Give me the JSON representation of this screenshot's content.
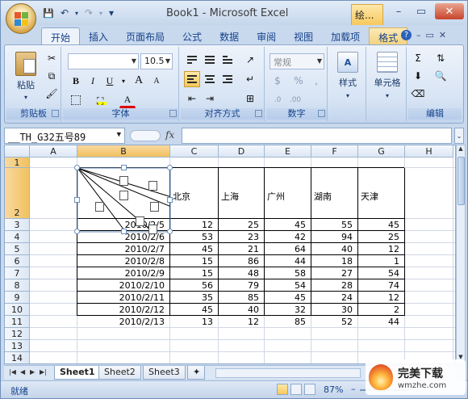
{
  "window": {
    "title": "Book1 - Microsoft Excel",
    "context_tab": "绘...",
    "minimize": "–",
    "restore": "▭",
    "close": "✕"
  },
  "qat": {
    "save": "💾",
    "undo": "↶",
    "redo": "↷",
    "more": "▾"
  },
  "ribbon_tabs": [
    "开始",
    "插入",
    "页面布局",
    "公式",
    "数据",
    "审阅",
    "视图",
    "加载项",
    "格式"
  ],
  "ribbon_right": {
    "help": "?",
    "min": "–",
    "restore": "▭",
    "close": "✕"
  },
  "groups": {
    "clipboard": {
      "label": "剪贴板",
      "paste": "粘贴"
    },
    "font": {
      "label": "字体",
      "size": "10.5",
      "bold": "B",
      "italic": "I",
      "underline": "U",
      "grow": "A",
      "shrink": "A",
      "font_color": "A"
    },
    "alignment": {
      "label": "对齐方式"
    },
    "number": {
      "label": "数字",
      "format": "常规",
      "percent": "%",
      "comma": ","
    },
    "style": {
      "label": "样式"
    },
    "cells": {
      "label": "单元格"
    },
    "editing": {
      "label": "编辑"
    }
  },
  "formula_bar": {
    "name_box": "__TH_G32五号89",
    "fx": "fx",
    "value": ""
  },
  "columns": [
    "A",
    "B",
    "C",
    "D",
    "E",
    "F",
    "G",
    "H"
  ],
  "rows": [
    "1",
    "2",
    "3",
    "4",
    "5",
    "6",
    "7",
    "8",
    "9",
    "10",
    "11",
    "12",
    "13",
    "14"
  ],
  "table": {
    "headers": [
      "北京",
      "上海",
      "广州",
      "湖南",
      "天津"
    ],
    "rows": [
      [
        "2010/2/5",
        "12",
        "25",
        "45",
        "55",
        "45"
      ],
      [
        "2010/2/6",
        "53",
        "23",
        "42",
        "94",
        "25"
      ],
      [
        "2010/2/7",
        "45",
        "21",
        "64",
        "40",
        "12"
      ],
      [
        "2010/2/8",
        "15",
        "86",
        "44",
        "18",
        "1"
      ],
      [
        "2010/2/9",
        "15",
        "48",
        "58",
        "27",
        "54"
      ],
      [
        "2010/2/10",
        "56",
        "79",
        "54",
        "28",
        "74"
      ],
      [
        "2010/2/11",
        "35",
        "85",
        "45",
        "24",
        "12"
      ],
      [
        "2010/2/12",
        "45",
        "40",
        "32",
        "30",
        "2"
      ],
      [
        "2010/2/13",
        "13",
        "12",
        "85",
        "52",
        "44"
      ]
    ]
  },
  "sheet_tabs": [
    "Sheet1",
    "Sheet2",
    "Sheet3"
  ],
  "status": {
    "ready": "就绪",
    "zoom": "87%",
    "zoom_minus": "–",
    "zoom_plus": "+"
  },
  "watermark": {
    "title": "完美下载",
    "subtitle": "wmzhe.com"
  }
}
